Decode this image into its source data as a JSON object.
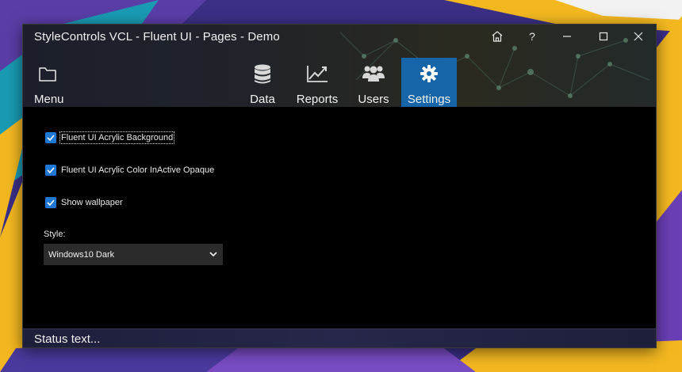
{
  "window": {
    "title": "StyleControls VCL - Fluent UI - Pages - Demo"
  },
  "caption_buttons": {
    "home_icon": "home-icon",
    "help_label": "?",
    "minimize_icon": "minimize-icon",
    "maximize_icon": "maximize-icon",
    "close_icon": "close-icon"
  },
  "menu": {
    "label": "Menu",
    "icon": "folder-icon"
  },
  "tabs": [
    {
      "label": "Data",
      "icon": "database-icon",
      "selected": false
    },
    {
      "label": "Reports",
      "icon": "chart-line-icon",
      "selected": false
    },
    {
      "label": "Users",
      "icon": "users-icon",
      "selected": false
    },
    {
      "label": "Settings",
      "icon": "gear-icon",
      "selected": true
    }
  ],
  "settings": {
    "options": [
      {
        "label": "Fluent UI Acrylic Background",
        "checked": true
      },
      {
        "label": "Fluent UI Acrylic Color InActive Opaque",
        "checked": true
      },
      {
        "label": "Show wallpaper",
        "checked": true
      }
    ],
    "style_label": "Style:",
    "style_value": "Windows10 Dark"
  },
  "status": {
    "text": "Status text..."
  },
  "colors": {
    "accent": "#1565a8",
    "checkbox": "#1e78d4",
    "content_bg": "#000000"
  }
}
